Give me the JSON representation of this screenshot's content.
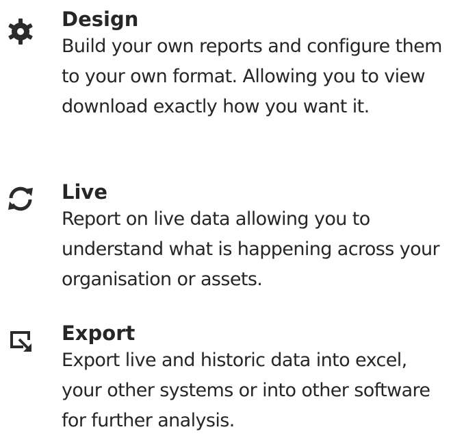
{
  "features": [
    {
      "icon": "gear-icon",
      "title": "Design",
      "description": "Build your own reports and configure them to your own format. Allowing you to view download exactly how you want it."
    },
    {
      "icon": "refresh-icon",
      "title": "Live",
      "description": "Report on live data allowing you to understand what is happening across your organisation or assets."
    },
    {
      "icon": "export-icon",
      "title": "Export",
      "description": "Export live and historic data into excel, your other systems or into other software for further analysis."
    }
  ],
  "colors": {
    "text": "#262626",
    "icon": "#2b2b2b",
    "background": "#ffffff"
  }
}
